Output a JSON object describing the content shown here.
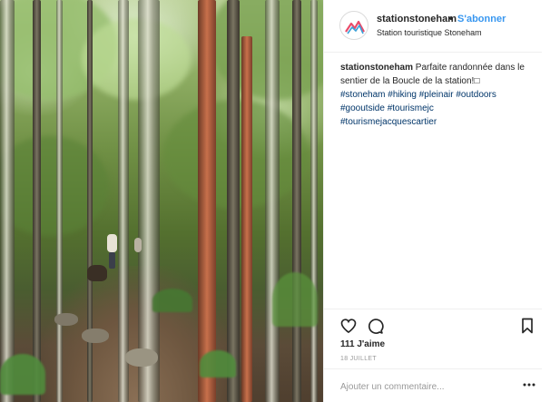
{
  "header": {
    "username": "stationstoneham",
    "separator": "•",
    "follow_label": "S'abonner",
    "location": "Station touristique Stoneham",
    "avatar_icon": "mountain-logo-icon"
  },
  "caption": {
    "username": "stationstoneham",
    "text": "Parfaite randonnée dans le sentier de la Boucle de la station!",
    "emoji_placeholder": "□",
    "hashtags_inline": [
      "#stoneham",
      "#hiking",
      "#pleinair",
      "#outdoors"
    ],
    "hashtags_line2": [
      "#gooutside",
      "#tourismejc"
    ],
    "hashtags_line3": [
      "#tourismejacquescartier"
    ]
  },
  "actions": {
    "like_icon": "heart-outline-icon",
    "comment_icon": "comment-bubble-icon",
    "save_icon": "bookmark-outline-icon"
  },
  "likes_text": "111 J'aime",
  "date_text": "18 juillet",
  "comment": {
    "placeholder": "Ajouter un commentaire...",
    "more_icon": "more-options-icon"
  },
  "colors": {
    "link_blue": "#3897f0",
    "hashtag_blue": "#003569",
    "text": "#262626",
    "muted": "#999999",
    "divider": "#efefef"
  }
}
